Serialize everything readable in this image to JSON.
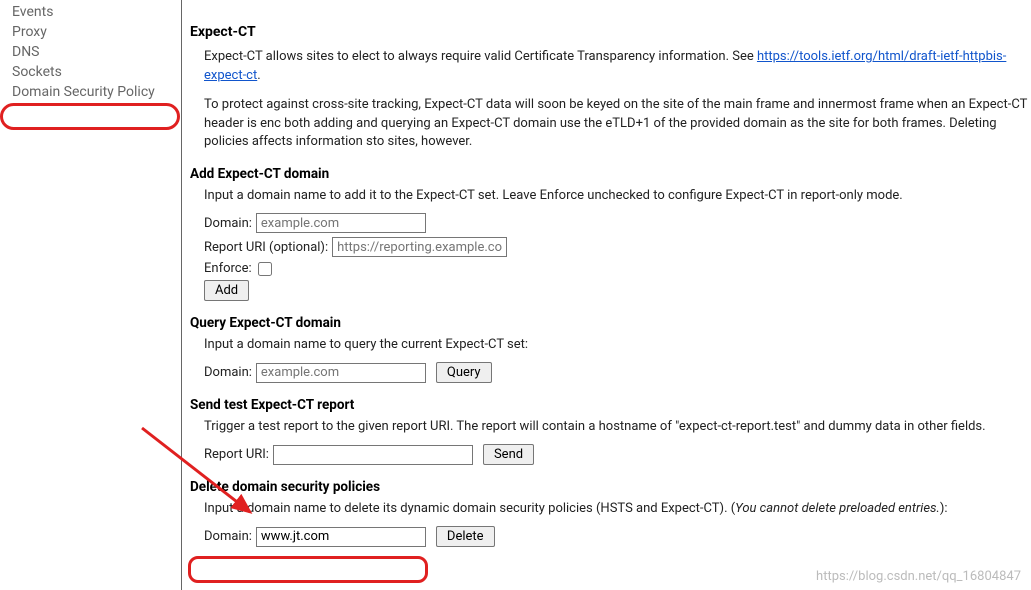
{
  "sidebar": {
    "items": [
      {
        "label": "Events"
      },
      {
        "label": "Proxy"
      },
      {
        "label": "DNS"
      },
      {
        "label": "Sockets"
      },
      {
        "label": "Domain Security Policy"
      }
    ]
  },
  "expect_ct": {
    "title": "Expect-CT",
    "intro_before_link": "Expect-CT allows sites to elect to always require valid Certificate Transparency information. See ",
    "link_text": "https://tools.ietf.org/html/draft-ietf-httpbis-expect-ct",
    "intro_after_link": ".",
    "protect_text": "To protect against cross-site tracking, Expect-CT data will soon be keyed on the site of the main frame and innermost frame when an Expect-CT header is enc both adding and querying an Expect-CT domain use the eTLD+1 of the provided domain as the site for both frames. Deleting policies affects information sto sites, however."
  },
  "add_section": {
    "title": "Add Expect-CT domain",
    "help": "Input a domain name to add it to the Expect-CT set. Leave Enforce unchecked to configure Expect-CT in report-only mode.",
    "domain_label": "Domain:",
    "domain_placeholder": "example.com",
    "report_uri_label": "Report URI (optional):",
    "report_uri_placeholder": "https://reporting.example.com",
    "enforce_label": "Enforce:",
    "add_button": "Add"
  },
  "query_section": {
    "title": "Query Expect-CT domain",
    "help": "Input a domain name to query the current Expect-CT set:",
    "domain_label": "Domain:",
    "domain_placeholder": "example.com",
    "query_button": "Query"
  },
  "send_section": {
    "title": "Send test Expect-CT report",
    "help": "Trigger a test report to the given report URI. The report will contain a hostname of \"expect-ct-report.test\" and dummy data in other fields.",
    "report_uri_label": "Report URI:",
    "send_button": "Send"
  },
  "delete_section": {
    "title": "Delete domain security policies",
    "help_before_italic": "Input a domain name to delete its dynamic domain security policies (HSTS and Expect-CT). (",
    "help_italic": "You cannot delete preloaded entries.",
    "help_after_italic": "):",
    "domain_label": "Domain:",
    "domain_value": "www.jt.com",
    "delete_button": "Delete"
  },
  "watermark": "https://blog.csdn.net/qq_16804847"
}
